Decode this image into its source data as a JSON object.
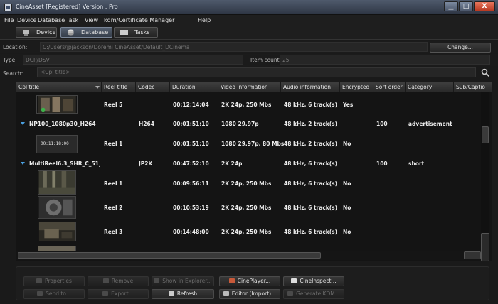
{
  "window": {
    "title": "CineAsset [Registered] Version : Pro",
    "minimize_glyph": "▁",
    "maximize_glyph": "□",
    "close_glyph": "X"
  },
  "menu": [
    "File",
    "Device",
    "Database",
    "Task",
    "View",
    "kdm/Certificate Manager",
    "Help"
  ],
  "tabs": [
    {
      "label": "Device",
      "icon": "device-icon",
      "active": false
    },
    {
      "label": "Database",
      "icon": "database-icon",
      "active": true
    },
    {
      "label": "Tasks",
      "icon": "tasks-icon",
      "active": false
    }
  ],
  "location": {
    "label": "Location:",
    "value": "C:/Users/jpjackson/Doremi CineAsset/Default_DCinema",
    "change_button": "Change..."
  },
  "type": {
    "label": "Type:",
    "value": "DCP/DSV"
  },
  "item_count": {
    "label": "Item count:",
    "value": "25"
  },
  "search": {
    "label": "Search:",
    "placeholder": "<Cpl title>"
  },
  "columns": [
    "Cpl title",
    "Reel title",
    "Codec",
    "Duration",
    "Video information",
    "Audio information",
    "Encrypted",
    "Sort order",
    "Category",
    "Sub/Captio"
  ],
  "rows": [
    {
      "kind": "reel",
      "thumb": "scene-dark-people",
      "reel_title": "Reel 5",
      "codec": "",
      "duration": "00:12:14:04",
      "video": "2K 24p, 250 Mbs",
      "audio": "48 kHz, 6 track(s)",
      "encrypted": "Yes",
      "sort_order": "",
      "category": ""
    },
    {
      "kind": "cpl",
      "cpl_title": "NP100_1080p30_H264",
      "codec": "H264",
      "duration": "00:01:51:10",
      "video": "1080 29.97p",
      "audio": "48 kHz, 2 track(s)",
      "encrypted": "",
      "sort_order": "100",
      "category": "advertisement"
    },
    {
      "kind": "reel",
      "thumb": "timecode-slate",
      "thumb_text": "00:11:18:00",
      "reel_title": "Reel 1",
      "codec": "",
      "duration": "00:01:51:10",
      "video": "1080 29.97p, 80 Mbs",
      "audio": "48 kHz, 2 track(s)",
      "encrypted": "No",
      "sort_order": "",
      "category": ""
    },
    {
      "kind": "cpl",
      "cpl_title": "MultiReel6.3_SHR_C_51_...",
      "codec": "JP2K",
      "duration": "00:47:52:10",
      "video": "2K 24p",
      "audio": "48 kHz, 6 track(s)",
      "encrypted": "",
      "sort_order": "100",
      "category": "short"
    },
    {
      "kind": "reel",
      "thumb": "scene-forest",
      "reel_title": "Reel 1",
      "codec": "",
      "duration": "00:09:56:11",
      "video": "2K 24p, 250 Mbs",
      "audio": "48 kHz, 6 track(s)",
      "encrypted": "No",
      "sort_order": "",
      "category": ""
    },
    {
      "kind": "reel",
      "thumb": "scene-machine",
      "reel_title": "Reel 2",
      "codec": "",
      "duration": "00:10:53:19",
      "video": "2K 24p, 250 Mbs",
      "audio": "48 kHz, 6 track(s)",
      "encrypted": "No",
      "sort_order": "",
      "category": ""
    },
    {
      "kind": "reel",
      "thumb": "scene-landscape",
      "reel_title": "Reel 3",
      "codec": "",
      "duration": "00:14:48:00",
      "video": "2K 24p, 250 Mbs",
      "audio": "48 kHz, 6 track(s)",
      "encrypted": "No",
      "sort_order": "",
      "category": ""
    }
  ],
  "actions": {
    "row1": [
      {
        "label": "Properties",
        "enabled": false,
        "icon": "properties-icon"
      },
      {
        "label": "Remove",
        "enabled": false,
        "icon": "remove-icon"
      },
      {
        "label": "Show in Explorer...",
        "enabled": false,
        "icon": "folder-icon"
      },
      {
        "label": "CinePlayer...",
        "enabled": true,
        "icon": "player-icon"
      },
      {
        "label": "CineInspect...",
        "enabled": true,
        "icon": "inspect-icon"
      }
    ],
    "row2": [
      {
        "label": "Send to...",
        "enabled": false,
        "icon": "send-icon"
      },
      {
        "label": "Export...",
        "enabled": false,
        "icon": "export-icon"
      },
      {
        "label": "Refresh",
        "enabled": true,
        "icon": "refresh-icon"
      },
      {
        "label": "Editor (Import)...",
        "enabled": true,
        "icon": "editor-icon"
      },
      {
        "label": "Generate KDM...",
        "enabled": false,
        "icon": "key-icon"
      }
    ]
  },
  "colors": {
    "accent": "#4aa0e0",
    "background": "#1a1a1a",
    "titlebar": "#3a4454",
    "close_button": "#c84a30"
  }
}
